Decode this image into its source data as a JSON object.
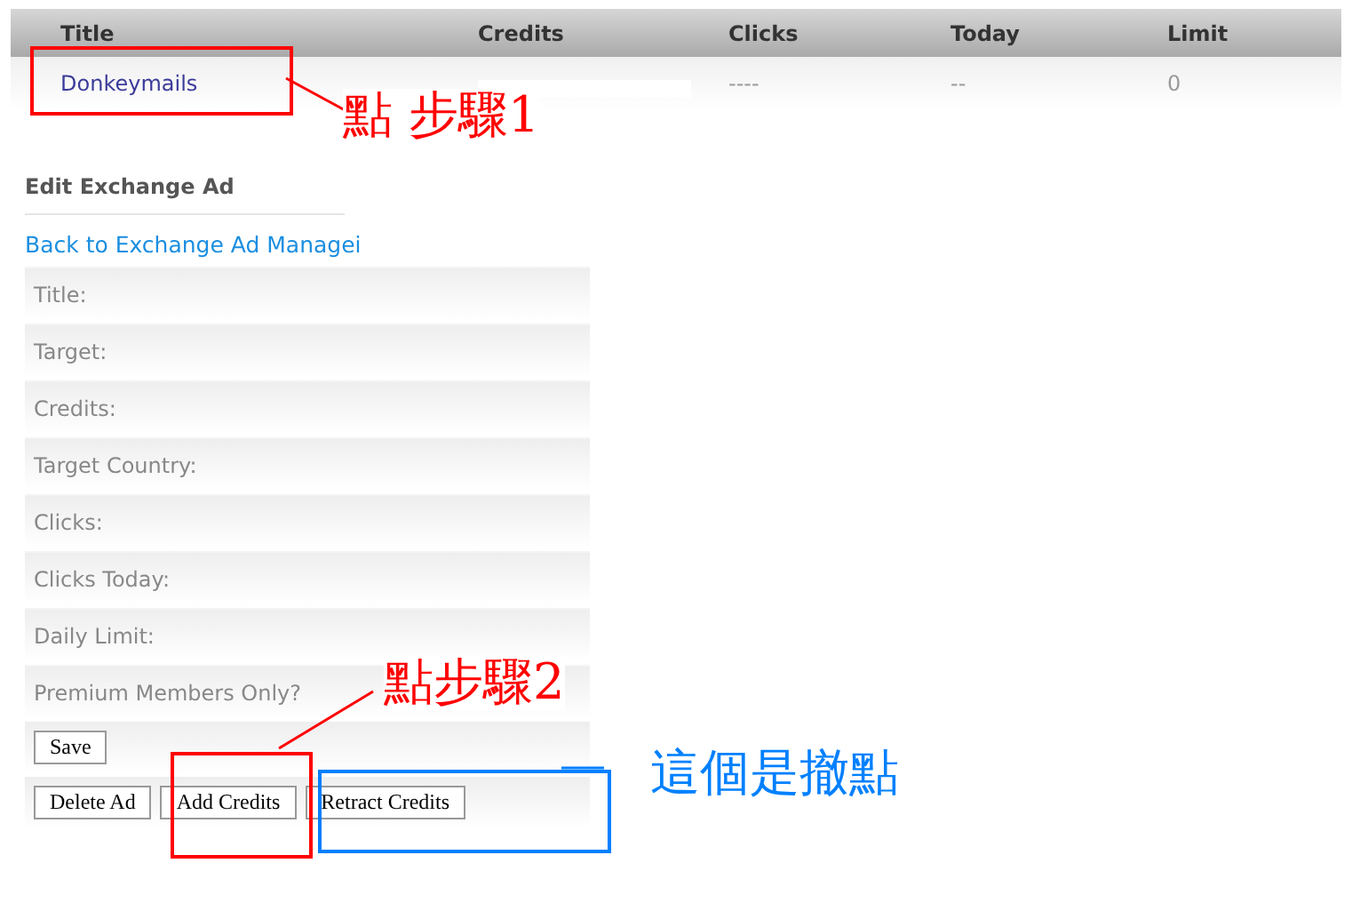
{
  "table": {
    "columns": [
      "Title",
      "Credits",
      "Clicks",
      "Today",
      "Limit"
    ],
    "rows": [
      {
        "title": "Donkeymails",
        "clicks": "----",
        "today": "--",
        "limit": "0"
      }
    ]
  },
  "form": {
    "heading": "Edit Exchange Ad",
    "back_link": "Back to Exchange Ad Managei",
    "fields": [
      "Title:",
      "Target:",
      "Credits:",
      "Target Country:",
      "Clicks:",
      "Clicks Today:",
      "Daily Limit:",
      "Premium Members Only?"
    ],
    "save_button": "Save",
    "action_buttons": [
      "Delete Ad",
      "Add Credits",
      "Retract Credits"
    ]
  },
  "annotations": [
    {
      "text": "點 步驟1",
      "color": "#ff0000"
    },
    {
      "text": "點步驟2",
      "color": "#ff0000"
    },
    {
      "text": "這個是撤點",
      "color": "#0080ff"
    }
  ]
}
